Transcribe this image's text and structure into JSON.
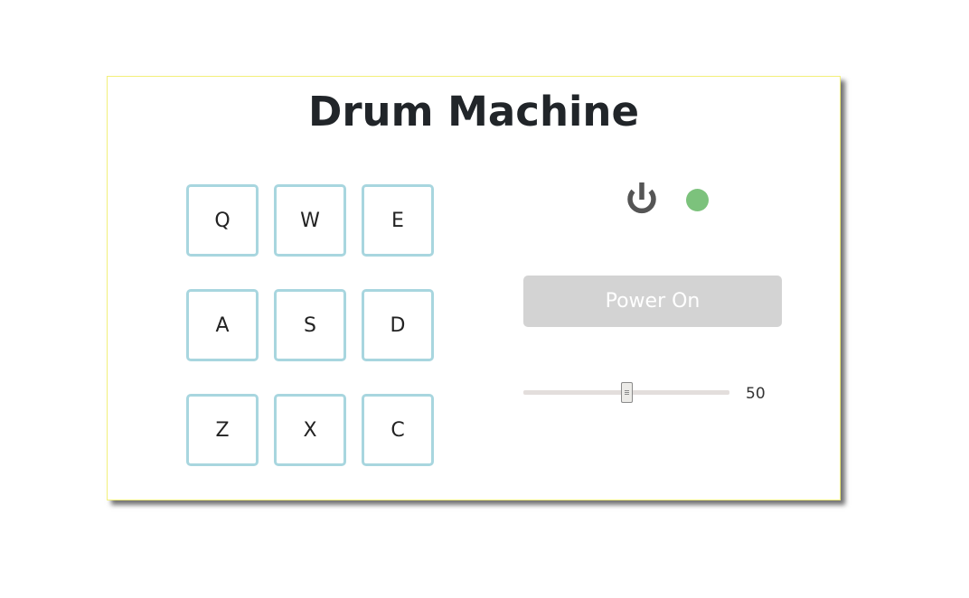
{
  "app": {
    "title": "Drum Machine"
  },
  "pads": [
    {
      "key": "Q"
    },
    {
      "key": "W"
    },
    {
      "key": "E"
    },
    {
      "key": "A"
    },
    {
      "key": "S"
    },
    {
      "key": "D"
    },
    {
      "key": "Z"
    },
    {
      "key": "X"
    },
    {
      "key": "C"
    }
  ],
  "power": {
    "icon": "power-icon",
    "led_color": "#7cc27c",
    "icon_color": "#555555"
  },
  "display": {
    "text": "Power On",
    "background": "#d3d3d3"
  },
  "volume": {
    "value": 50,
    "label": "50",
    "min": 0,
    "max": 100,
    "track_color": "#e3dedc"
  },
  "theme": {
    "pad_border": "#a8d6df",
    "panel_border": "#f3f07a"
  }
}
